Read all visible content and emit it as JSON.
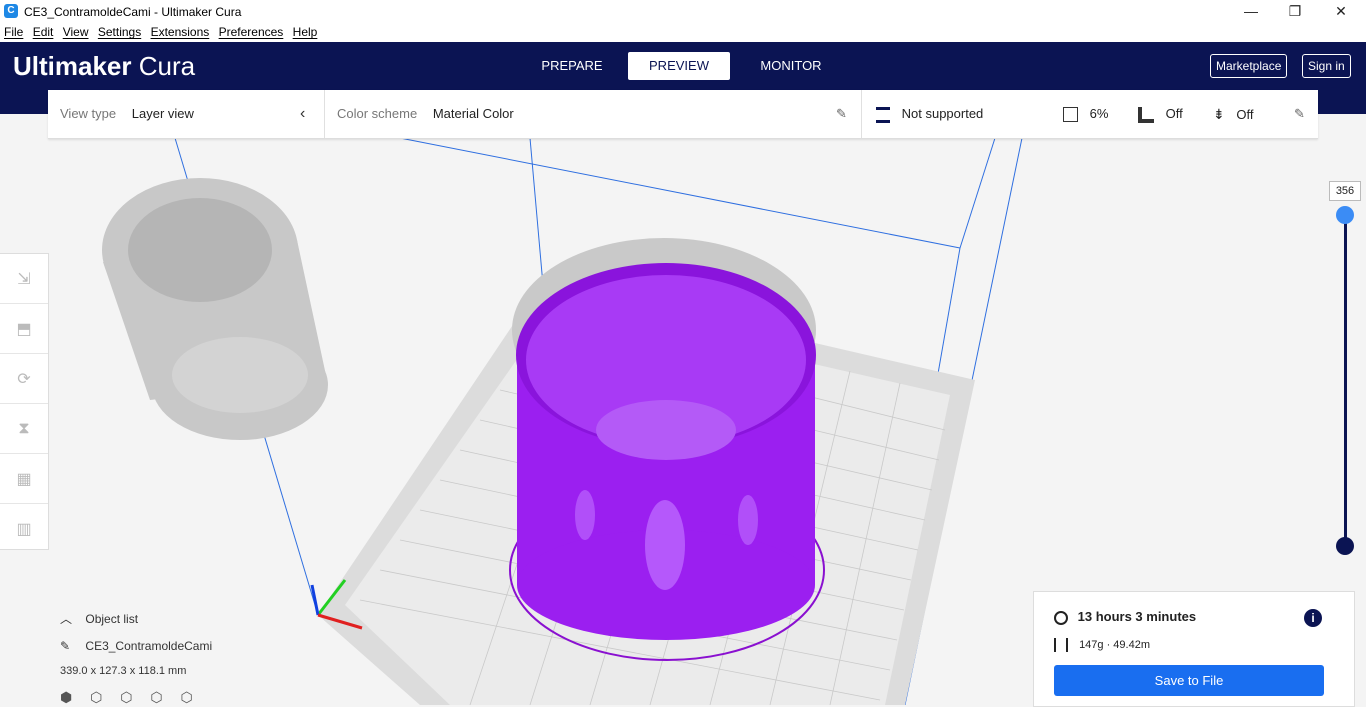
{
  "window": {
    "title": "CE3_ContramoldeCami - Ultimaker Cura",
    "minimize": "—",
    "maximize": "❐",
    "close": "✕"
  },
  "menu": [
    "File",
    "Edit",
    "View",
    "Settings",
    "Extensions",
    "Preferences",
    "Help"
  ],
  "header": {
    "logo_bold": "Ultimaker",
    "logo_light": " Cura",
    "tabs": [
      "PREPARE",
      "PREVIEW",
      "MONITOR"
    ],
    "active_tab": "PREVIEW",
    "marketplace": "Marketplace",
    "sign_in": "Sign in"
  },
  "viewbar": {
    "view_type_label": "View type",
    "view_type_value": "Layer view",
    "color_scheme_label": "Color scheme",
    "color_scheme_value": "Material Color",
    "support": "Not supported",
    "infill": "6%",
    "support_toggle": "Off",
    "adhesion": "Off"
  },
  "layer_slider": {
    "current_layer": "356"
  },
  "object_list": {
    "title": "Object list",
    "object_name": "CE3_ContramoldeCami",
    "dimensions": "339.0 x 127.3 x 118.1 mm"
  },
  "print_info": {
    "time": "13 hours 3 minutes",
    "material": "147g · 49.42m",
    "save_button": "Save to File"
  },
  "colors": {
    "header_bg": "#0b1453",
    "accent": "#196ef0",
    "material": "#9b1ff0"
  }
}
